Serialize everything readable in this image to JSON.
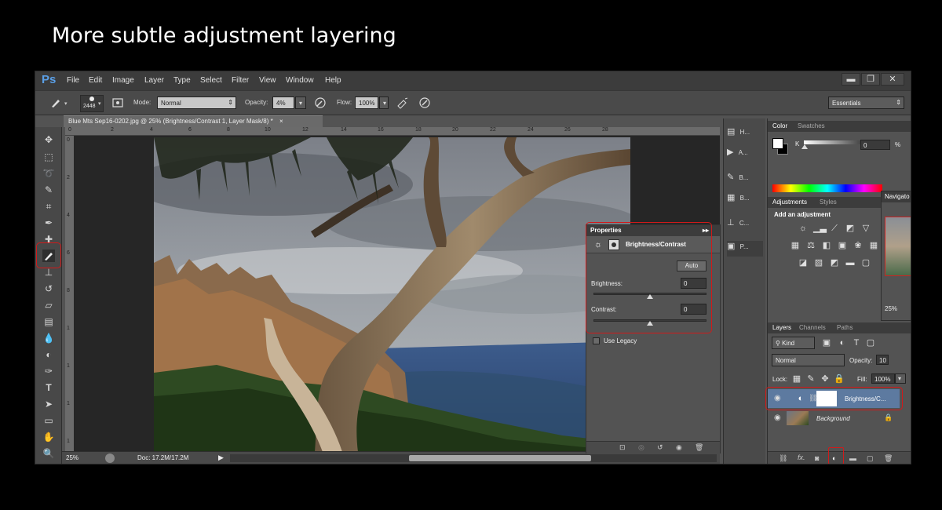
{
  "slide_title": "More subtle adjustment layering",
  "app": {
    "logo": "Ps",
    "menu": [
      "File",
      "Edit",
      "Image",
      "Layer",
      "Type",
      "Select",
      "Filter",
      "View",
      "Window",
      "Help"
    ],
    "window_controls": {
      "minimize": "▬",
      "restore": "❐",
      "close": "✕"
    }
  },
  "options_bar": {
    "brush_size": "2448",
    "mode_label": "Mode:",
    "mode_value": "Normal",
    "opacity_label": "Opacity:",
    "opacity_value": "4%",
    "flow_label": "Flow:",
    "flow_value": "100%",
    "workspace": "Essentials"
  },
  "document": {
    "tab_title": "Blue Mts Sep16-0202.jpg @ 25% (Brightness/Contrast 1, Layer Mask/8) *",
    "tab_close": "×",
    "ruler_h": [
      "0",
      "2",
      "4",
      "6",
      "8",
      "10",
      "12",
      "14",
      "16",
      "18",
      "20",
      "22",
      "24",
      "26",
      "28"
    ],
    "ruler_v": [
      "0",
      "2",
      "4",
      "6",
      "8",
      "1",
      "1",
      "1",
      "1",
      "1"
    ],
    "zoom": "25%",
    "doc_size": "Doc: 17.2M/17.2M"
  },
  "properties": {
    "header": "Properties",
    "collapse": "▸▸",
    "title": "Brightness/Contrast",
    "auto_label": "Auto",
    "brightness_label": "Brightness:",
    "brightness_value": "0",
    "contrast_label": "Contrast:",
    "contrast_value": "0",
    "legacy_label": "Use Legacy"
  },
  "dock": {
    "items": [
      "H...",
      "A...",
      "B...",
      "B...",
      "C...",
      "P..."
    ]
  },
  "color_panel": {
    "tabs": [
      "Color",
      "Swatches"
    ],
    "k_label": "K",
    "k_value": "0",
    "k_unit": "%"
  },
  "adjustments_panel": {
    "tabs": [
      "Adjustments",
      "Styles"
    ],
    "heading": "Add an adjustment"
  },
  "navigator": {
    "title": "Navigato",
    "zoom": "25%"
  },
  "layers_panel": {
    "tabs": [
      "Layers",
      "Channels",
      "Paths"
    ],
    "kind_label": "Kind",
    "blend_mode": "Normal",
    "opacity_label": "Opacity:",
    "opacity_value": "10",
    "lock_label": "Lock:",
    "fill_label": "Fill:",
    "fill_value": "100%",
    "layers": [
      {
        "name": "Brightness/C...",
        "selected": true
      },
      {
        "name": "Background",
        "selected": false
      }
    ]
  },
  "colors": {
    "highlight": "#d11a1a",
    "selected_layer": "#5d7aa0",
    "ps_blue": "#5a9fe6"
  }
}
